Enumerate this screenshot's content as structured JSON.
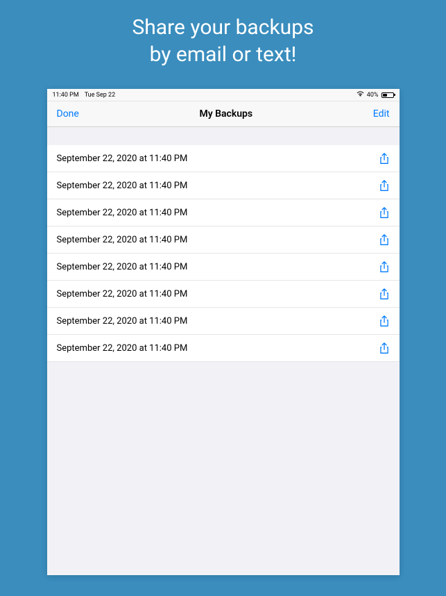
{
  "promo": {
    "line1": "Share your backups",
    "line2": "by email or text!"
  },
  "statusBar": {
    "time": "11:40 PM",
    "date": "Tue Sep 22",
    "battery": "40%"
  },
  "navBar": {
    "left": "Done",
    "title": "My Backups",
    "right": "Edit"
  },
  "backups": [
    {
      "label": "September 22, 2020 at 11:40 PM"
    },
    {
      "label": "September 22, 2020 at 11:40 PM"
    },
    {
      "label": "September 22, 2020 at 11:40 PM"
    },
    {
      "label": "September 22, 2020 at 11:40 PM"
    },
    {
      "label": "September 22, 2020 at 11:40 PM"
    },
    {
      "label": "September 22, 2020 at 11:40 PM"
    },
    {
      "label": "September 22, 2020 at 11:40 PM"
    },
    {
      "label": "September 22, 2020 at 11:40 PM"
    }
  ]
}
